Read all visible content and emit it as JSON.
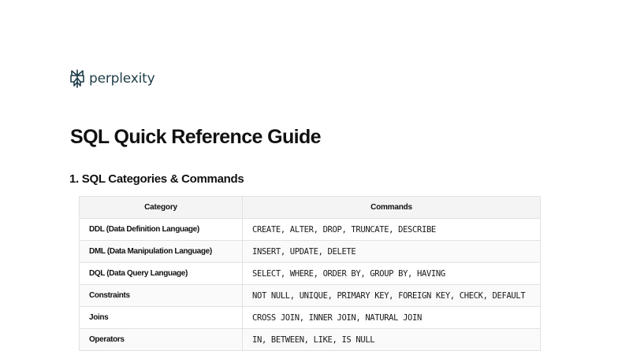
{
  "header": {
    "logo_icon": "perplexity-logo-icon",
    "logo_text": "perplexity",
    "logo_color": "#1f3d48"
  },
  "document": {
    "title": "SQL Quick Reference Guide",
    "section_1_heading": "1. SQL Categories & Commands"
  },
  "table": {
    "columns": [
      "Category",
      "Commands"
    ],
    "rows": [
      {
        "category": "DDL (Data Definition Language)",
        "commands": "CREATE, ALTER, DROP, TRUNCATE, DESCRIBE"
      },
      {
        "category": "DML (Data Manipulation Language)",
        "commands": "INSERT, UPDATE, DELETE"
      },
      {
        "category": "DQL (Data Query Language)",
        "commands": "SELECT, WHERE, ORDER BY, GROUP BY, HAVING"
      },
      {
        "category": "Constraints",
        "commands": "NOT NULL, UNIQUE, PRIMARY KEY, FOREIGN KEY, CHECK, DEFAULT"
      },
      {
        "category": "Joins",
        "commands": "CROSS JOIN, INNER JOIN, NATURAL JOIN"
      },
      {
        "category": "Operators",
        "commands": "IN, BETWEEN, LIKE, IS NULL"
      }
    ]
  }
}
